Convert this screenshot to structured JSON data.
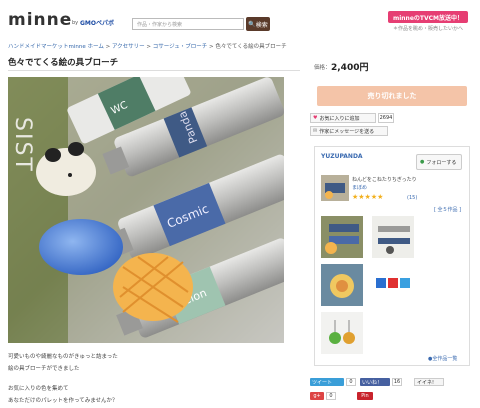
{
  "header": {
    "logo": "minne",
    "by": "by",
    "gmo": "GMOペパボ",
    "search_placeholder": "作品・作家から検索",
    "search_button": "検索",
    "tv_banner": "minneのTVCM放送中！",
    "tv_sub": "＊作品を眺め・販売したいかへ"
  },
  "breadcrumb": {
    "items": [
      "ハンドメイドマーケットminne ホーム",
      "アクセサリー",
      "コサージュ・ブローチ",
      "色々でてくる絵の具ブローチ"
    ],
    "separator": ">"
  },
  "product": {
    "title": "色々でてくる絵の具ブローチ",
    "price_label": "価格：",
    "price": "2,400円",
    "sold_out": "売り切れました",
    "desc_lines": [
      "可愛いものや綺麗なものがきゅっと詰まった",
      "絵の具ブローチができました",
      "",
      "お気に入りの色を集めて",
      "あなただけのパレットを作ってみませんか？"
    ]
  },
  "actions": {
    "favorite": "お気に入りに追加",
    "favorite_count": "2694",
    "message": "作家にメッセージを送る"
  },
  "shop": {
    "name": "YUZUPANDA",
    "follow": "フォローする",
    "desc_line1": "ねんどをこねたりちぎったり",
    "desc_line2": "まぼめ",
    "reviews": "(15)",
    "all_works_count": "[ 全５作品 ]",
    "all_works_link": "●全作品一覧"
  },
  "social": {
    "tweet": "ツイート",
    "tweet_count": "0",
    "iine": "いいね！",
    "iine_count": "16",
    "iine2": "イイネ!",
    "gplus": "g+",
    "gplus_count": "0",
    "pin": "Pin"
  }
}
